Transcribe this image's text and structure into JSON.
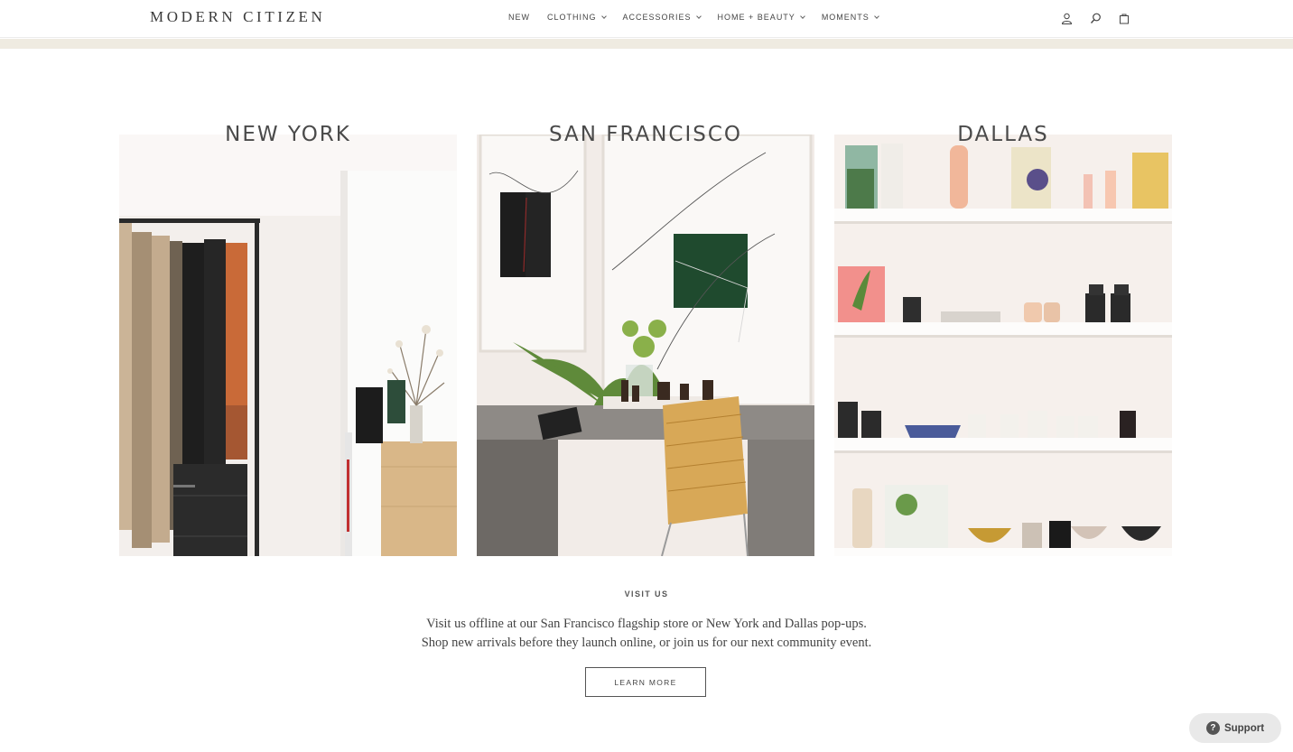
{
  "header": {
    "logo": "MODERN CITIZEN",
    "nav": [
      {
        "label": "NEW",
        "has_dropdown": false
      },
      {
        "label": "CLOTHING",
        "has_dropdown": true
      },
      {
        "label": "ACCESSORIES",
        "has_dropdown": true
      },
      {
        "label": "HOME + BEAUTY",
        "has_dropdown": true
      },
      {
        "label": "MOMENTS",
        "has_dropdown": true
      }
    ],
    "icons": [
      "account-icon",
      "search-icon",
      "cart-icon"
    ]
  },
  "stores": [
    {
      "title": "NEW YORK"
    },
    {
      "title": "SAN FRANCISCO"
    },
    {
      "title": "DALLAS"
    }
  ],
  "visit": {
    "label": "VISIT US",
    "line1": "Visit us offline at our San Francisco flagship store or New York and Dallas pop-ups.",
    "line2": "Shop new arrivals before they launch online, or join us for our next community event.",
    "button": "LEARN MORE"
  },
  "support": {
    "label": "Support"
  },
  "colors": {
    "strip": "#efebe1",
    "text": "#444444"
  }
}
